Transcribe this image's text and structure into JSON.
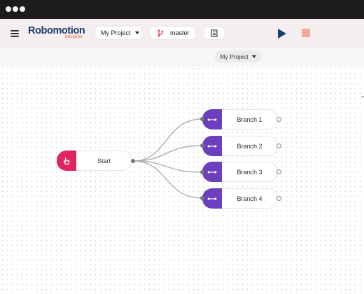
{
  "app": {
    "brand": "Robomotion",
    "brand_sub": "designer"
  },
  "toolbar": {
    "project_label": "My Project",
    "branch_label": "master",
    "icons": [
      "menu-icon",
      "git-branch-icon",
      "document-icon",
      "play-icon",
      "stop-icon"
    ]
  },
  "subbar": {
    "flow_label": "My Project"
  },
  "flow": {
    "start_label": "Start",
    "branches": [
      {
        "label": "Branch 1"
      },
      {
        "label": "Branch 2"
      },
      {
        "label": "Branch 3"
      },
      {
        "label": "Branch 4"
      }
    ]
  },
  "colors": {
    "start_head": "#e0245e",
    "branch_head": "#6b3fbd",
    "brand": "#1c3b6e",
    "brand_sub": "#e8673a",
    "stop": "#f4a89a",
    "toolbar_bg": "#f5eeee"
  }
}
